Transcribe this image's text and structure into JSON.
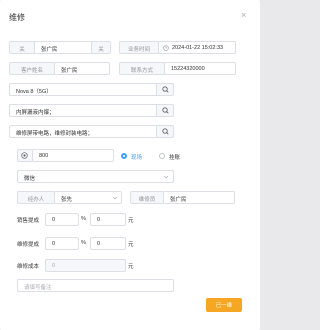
{
  "dialog": {
    "title": "维修",
    "close_icon": "close-icon"
  },
  "row1": {
    "tag_left": "关",
    "customer_value": "张广民",
    "tag_right": "关",
    "time_label": "业务时间",
    "time_value": "2024-01-22 15:02:33"
  },
  "row2": {
    "name_label": "客户姓名",
    "name_value": "张广民",
    "phone_label": "联系方式",
    "phone_value": "15224320000"
  },
  "device": {
    "value": "Nova 8（5G）"
  },
  "inner_screen": {
    "value": "内屏漏液内爆；"
  },
  "repair_item": {
    "value": "维修屏带电路，维修封装电路；"
  },
  "amount": {
    "value": "800",
    "option_a": "现场",
    "option_b": "挂账"
  },
  "payment": {
    "value": "微信"
  },
  "staff": {
    "handler_label": "经办人",
    "handler_value": "张先",
    "repairer_label": "维修员",
    "repairer_value": "张广民"
  },
  "sales_commission": {
    "label": "销售提成",
    "percent": "0",
    "amount": "0",
    "percent_unit": "%",
    "amount_unit": "元"
  },
  "repair_commission": {
    "label": "维修提成",
    "percent": "0",
    "amount": "0",
    "percent_unit": "%",
    "amount_unit": "元"
  },
  "repair_cost": {
    "label": "维修成本",
    "value": "0",
    "unit": "元"
  },
  "remark": {
    "placeholder": "请填写备注"
  },
  "actions": {
    "submit_label": "已一维"
  },
  "colors": {
    "accent": "#409eff",
    "primary_button": "#f5a623",
    "border": "#dcdfe6"
  }
}
